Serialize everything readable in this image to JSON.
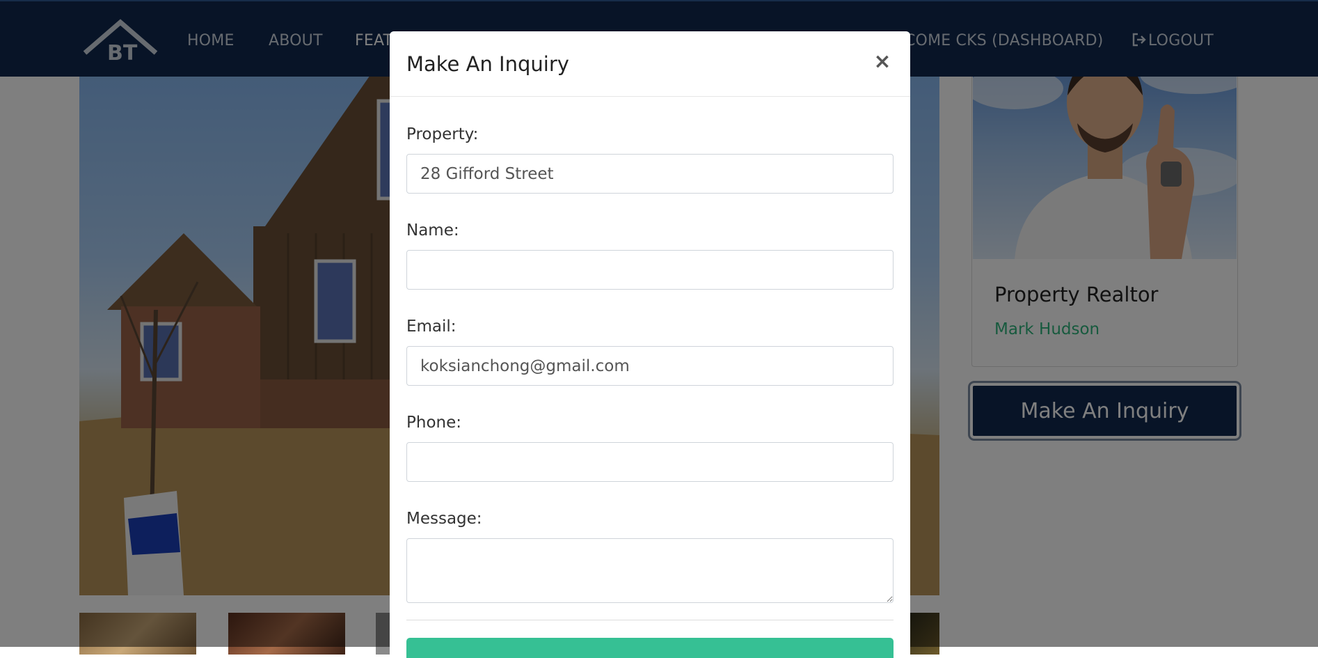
{
  "navbar": {
    "logo_text": "BT",
    "links": {
      "home": "HOME",
      "about": "ABOUT",
      "features": "FEAT",
      "welcome": "COME CKS (DASHBOARD)",
      "logout": "LOGOUT"
    }
  },
  "sidebar": {
    "realtor_title": "Property Realtor",
    "realtor_name": "Mark Hudson",
    "inquiry_button": "Make An Inquiry"
  },
  "modal": {
    "title": "Make An Inquiry",
    "close_symbol": "×",
    "labels": {
      "property": "Property:",
      "name": "Name:",
      "email": "Email:",
      "phone": "Phone:",
      "message": "Message:"
    },
    "values": {
      "property": "28 Gifford Street",
      "name": "",
      "email": "koksianchong@gmail.com",
      "phone": "",
      "message": ""
    }
  },
  "colors": {
    "navbar": "#10294f",
    "accent_green": "#36c094",
    "realtor_name": "#2fb47c"
  },
  "icons": [
    "logout-icon",
    "close-icon",
    "logo-icon"
  ]
}
